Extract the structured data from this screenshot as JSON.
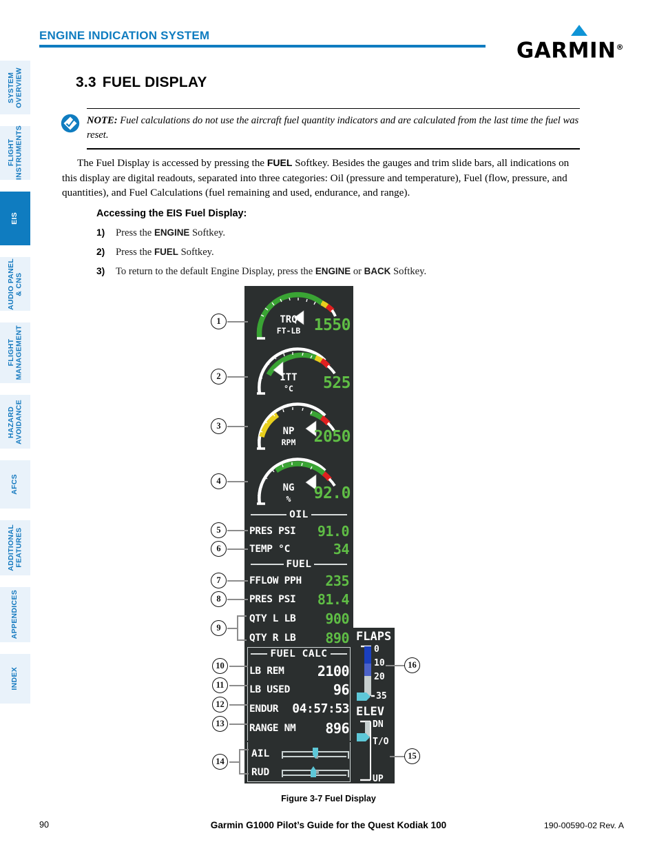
{
  "header": {
    "title": "ENGINE INDICATION SYSTEM",
    "brand": "GARMIN",
    "brand_mark": "®",
    "accent_color": "#0f7cc0"
  },
  "sidebar": {
    "items": [
      {
        "label": "SYSTEM\nOVERVIEW",
        "active": false
      },
      {
        "label": "FLIGHT\nINSTRUMENTS",
        "active": false
      },
      {
        "label": "EIS",
        "active": true
      },
      {
        "label": "AUDIO PANEL\n& CNS",
        "active": false
      },
      {
        "label": "FLIGHT\nMANAGEMENT",
        "active": false
      },
      {
        "label": "HAZARD\nAVOIDANCE",
        "active": false
      },
      {
        "label": "AFCS",
        "active": false
      },
      {
        "label": "ADDITIONAL\nFEATURES",
        "active": false
      },
      {
        "label": "APPENDICES",
        "active": false
      },
      {
        "label": "INDEX",
        "active": false
      }
    ]
  },
  "section": {
    "number": "3.3",
    "title": "FUEL DISPLAY"
  },
  "note": {
    "label": "NOTE:",
    "text": " Fuel calculations do not use the aircraft fuel quantity indicators and are calculated from the last time the fuel was reset."
  },
  "paragraph": {
    "part1": "The Fuel Display is accessed by pressing the ",
    "bold1": "FUEL",
    "part2": " Softkey.  Besides the gauges and trim slide bars, all indications on this display are digital readouts, separated into three categories: Oil (pressure and temperature), Fuel (flow, pressure, and quantities), and Fuel Calculations (fuel remaining and used, endurance, and range)."
  },
  "procedure": {
    "title": "Accessing the EIS Fuel Display:",
    "steps": [
      {
        "num": "1)",
        "pre": "Press the ",
        "bold": "ENGINE",
        "post": " Softkey."
      },
      {
        "num": "2)",
        "pre": "Press the ",
        "bold": "FUEL",
        "post": " Softkey."
      },
      {
        "num": "3)",
        "pre": "To return to the default Engine Display, press the ",
        "bold": "ENGINE",
        "mid": " or ",
        "bold2": "BACK",
        "post": " Softkey."
      }
    ]
  },
  "eis": {
    "bg_color": "#2b2f2f",
    "green": "#5fbd45",
    "gauges": [
      {
        "name": "TRQ",
        "unit": "FT-LB",
        "value": "1550"
      },
      {
        "name": "ITT",
        "unit": "°C",
        "value": "525"
      },
      {
        "name": "NP",
        "unit": "RPM",
        "value": "2050"
      },
      {
        "name": "NG",
        "unit": "%",
        "value": "92.0"
      }
    ],
    "sections": [
      {
        "heading": "OIL",
        "rows": [
          {
            "label": "PRES PSI",
            "value": "91.0",
            "color": "green"
          },
          {
            "label": "TEMP °C",
            "value": "34",
            "color": "green"
          }
        ]
      },
      {
        "heading": "FUEL",
        "rows": [
          {
            "label": "FFLOW PPH",
            "value": "235",
            "color": "green"
          },
          {
            "label": "PRES PSI",
            "value": "81.4",
            "color": "green"
          },
          {
            "label": "QTY L LB",
            "value": "900",
            "color": "green"
          },
          {
            "label": "QTY R LB",
            "value": "890",
            "color": "green"
          }
        ]
      },
      {
        "heading": "FUEL CALC",
        "rows": [
          {
            "label": "LB REM",
            "value": "2100",
            "color": "white"
          },
          {
            "label": "LB USED",
            "value": "96",
            "color": "white"
          },
          {
            "label": "ENDUR",
            "value": "04:57:53",
            "color": "white"
          },
          {
            "label": "RANGE NM",
            "value": "896",
            "color": "white"
          }
        ]
      }
    ],
    "trim": [
      {
        "label": "AIL"
      },
      {
        "label": "RUD"
      }
    ],
    "flaps": {
      "title": "FLAPS",
      "ticks": [
        "0",
        "10",
        "20",
        "35"
      ]
    },
    "elev": {
      "title": "ELEV",
      "ticks": [
        "DN",
        "T/O",
        "UP"
      ]
    }
  },
  "callouts": [
    {
      "n": "1"
    },
    {
      "n": "2"
    },
    {
      "n": "3"
    },
    {
      "n": "4"
    },
    {
      "n": "5"
    },
    {
      "n": "6"
    },
    {
      "n": "7"
    },
    {
      "n": "8"
    },
    {
      "n": "9"
    },
    {
      "n": "10"
    },
    {
      "n": "11"
    },
    {
      "n": "12"
    },
    {
      "n": "13"
    },
    {
      "n": "14"
    },
    {
      "n": "15"
    },
    {
      "n": "16"
    }
  ],
  "caption": "Figure 3-7  Fuel Display",
  "footer": {
    "page": "90",
    "title": "Garmin G1000 Pilot’s Guide for the Quest Kodiak 100",
    "doc": "190-00590-02  Rev. A"
  }
}
